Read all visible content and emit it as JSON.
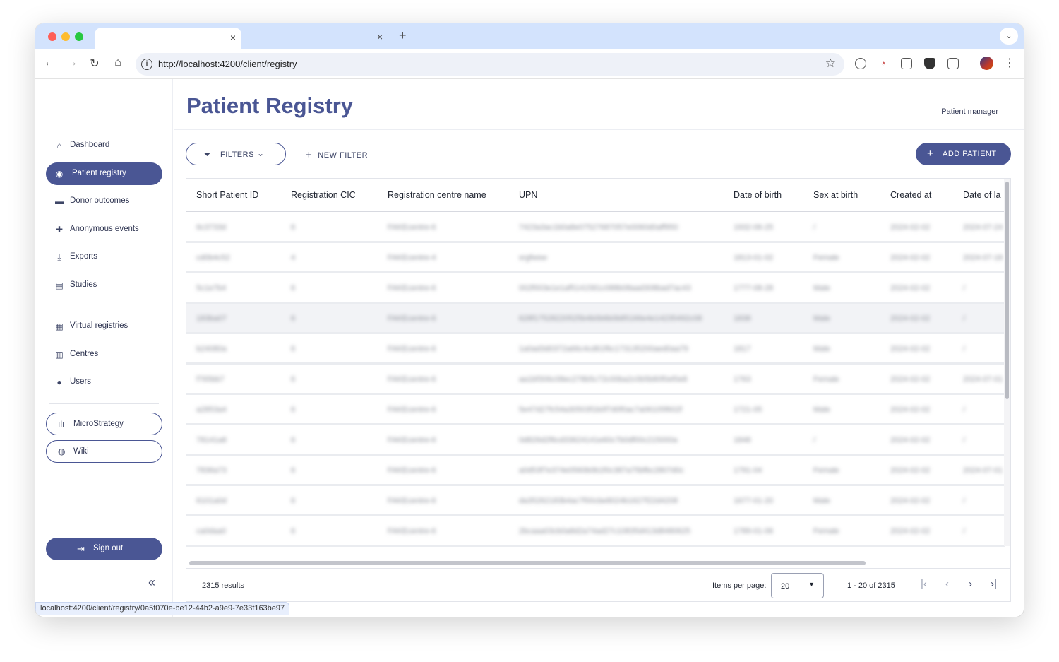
{
  "browser": {
    "url": "http://localhost:4200/client/registry",
    "status_url": "localhost:4200/client/registry/0a5f070e-be12-44b2-a9e9-7e33f163be97",
    "tab_close": "×",
    "new_tab": "+",
    "tab_menu": "⌄",
    "traffic_lights": [
      "#ff5f57",
      "#febc2e",
      "#28c840"
    ]
  },
  "app": {
    "page_title": "Patient Registry",
    "role": "Patient manager",
    "accent_color": "#4a5694"
  },
  "sidebar": {
    "items": [
      {
        "label": "Dashboard",
        "icon": "home-icon"
      },
      {
        "label": "Patient registry",
        "icon": "user-circle-icon",
        "active": true
      },
      {
        "label": "Donor outcomes",
        "icon": "folder-user-icon"
      },
      {
        "label": "Anonymous events",
        "icon": "medical-bag-icon"
      },
      {
        "label": "Exports",
        "icon": "download-icon"
      },
      {
        "label": "Studies",
        "icon": "archive-icon"
      }
    ],
    "items2": [
      {
        "label": "Virtual registries",
        "icon": "chart-box-icon"
      },
      {
        "label": "Centres",
        "icon": "building-icon"
      },
      {
        "label": "Users",
        "icon": "person-icon"
      }
    ],
    "links": [
      {
        "label": "MicroStrategy",
        "icon": "bar-chart-icon"
      },
      {
        "label": "Wiki",
        "icon": "globe-icon"
      }
    ],
    "sign_out": "Sign out"
  },
  "toolbar": {
    "filters_label": "FILTERS",
    "new_filter_label": "NEW FILTER",
    "add_patient_label": "ADD PATIENT"
  },
  "table": {
    "columns": [
      "Short Patient ID",
      "Registration CIC",
      "Registration centre name",
      "UPN",
      "Date of birth",
      "Sex at birth",
      "Created at",
      "Date of la"
    ],
    "rows": [
      [
        "6c3733d",
        "6",
        "FAKEcentre-6",
        "7423a3ac1b0a8e07527687057e0060d0aff950",
        "1932-06-25",
        "/",
        "2024-02-02",
        "2024-07-24"
      ],
      [
        "cd0b4c52",
        "4",
        "FAKEcentre-4",
        "srgfwsw",
        "1813-01-02",
        "Female",
        "2024-02-02",
        "2024-07-18"
      ],
      [
        "5c1e7b4",
        "6",
        "FAKEcentre-6",
        "002f003e1e1af5141581c088b08aad308bad7ac43",
        "1777-08-28",
        "Male",
        "2024-02-02",
        "/"
      ],
      [
        "183ba07",
        "6",
        "FAKEcentre-6",
        "628f17528220525b4b0b6b0b85166e4e14235492c08",
        "1838",
        "Male",
        "2024-02-02",
        "/"
      ],
      [
        "b24080a",
        "6",
        "FAKEcentre-6",
        "1a0ad3d0372a66c4cd61f6c173135200aed0aa79",
        "1817",
        "Male",
        "2024-02-02",
        "/"
      ],
      [
        "f765bb7",
        "6",
        "FAKEcentre-6",
        "aa1bf306c08ec278b5c72c00ba2c0b5b80f0ef0e8",
        "1763",
        "Female",
        "2024-02-02",
        "2024-07-01"
      ],
      [
        "a2853a4",
        "6",
        "FAKEcentre-6",
        "5e47d27fc54a30503f1b0f7d0f0ac7a06105f602f",
        "1721-05",
        "Male",
        "2024-02-02",
        "/"
      ],
      [
        "78141a8",
        "6",
        "FAKEcentre-6",
        "0d826d2f6cd33624141e60c7b0df00c215000a",
        "1848",
        "/",
        "2024-02-02",
        "/"
      ],
      [
        "7836a73",
        "6",
        "FAKEcentre-6",
        "a0d53f7e374e0560b0b1f0c387a75bfbc2807d0c",
        "1791-04",
        "Female",
        "2024-02-02",
        "2024-07-01"
      ],
      [
        "6101a0d",
        "6",
        "FAKEcentre-6",
        "da35262183b4ac7f00cbe8024b1627f22d4208",
        "1677-01-20",
        "Male",
        "2024-02-02",
        "/"
      ],
      [
        "ca0daa0",
        "6",
        "FAKEcentre-6",
        "2bcaaa03cb0a8d2a74ad27c10835d413d8480625",
        "1789-01-06",
        "Female",
        "2024-02-02",
        "/"
      ]
    ]
  },
  "footer": {
    "results": "2315 results",
    "items_per_page_label": "Items per page:",
    "items_per_page": "20",
    "range": "1 - 20 of 2315"
  }
}
